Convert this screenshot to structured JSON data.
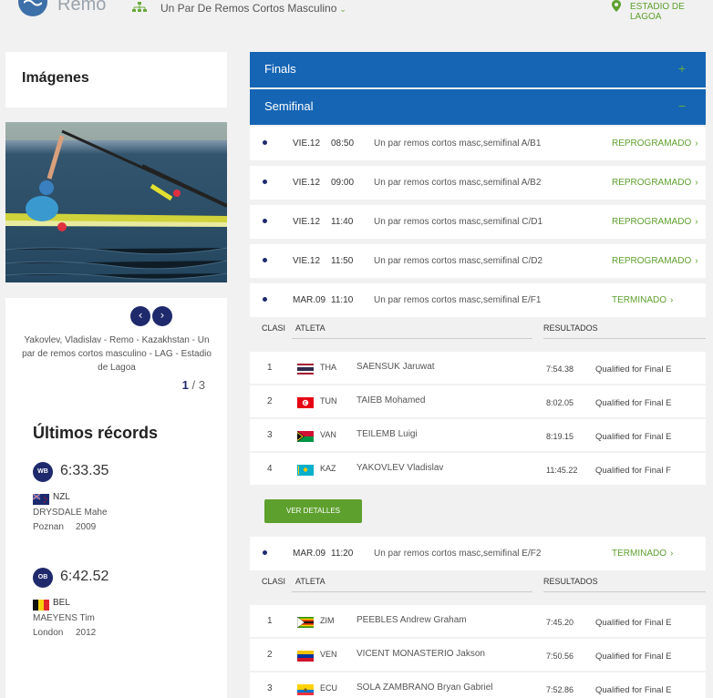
{
  "header": {
    "sport": "Remo",
    "event": "Un Par De Remos Cortos Masculino",
    "venue": "ESTADIO DE LAGOA"
  },
  "colors": {
    "brand_blue": "#1565b4",
    "accent_green": "#5ea02e",
    "navy": "#1f2a6d"
  },
  "images": {
    "title": "Imágenes",
    "caption": "Yakovlev, Vladislav - Remo - Kazakhstan - Un par de remos cortos masculino - LAG - Estadio de Lagoa",
    "current": "1",
    "total": "/ 3",
    "prev_icon": "‹",
    "next_icon": "›"
  },
  "records": {
    "title": "Últimos récords",
    "items": [
      {
        "badge": "WB",
        "time": "6:33.35",
        "noc": "NZL",
        "name": "DRYSDALE Mahe",
        "place": "Poznan",
        "year": "2009"
      },
      {
        "badge": "OB",
        "time": "6:42.52",
        "noc": "BEL",
        "name": "MAEYENS Tim",
        "place": "London",
        "year": "2012"
      }
    ]
  },
  "phases": [
    {
      "label": "Finals",
      "toggle": "+"
    },
    {
      "label": "Semifinal",
      "toggle": "−"
    }
  ],
  "races": [
    {
      "day": "VIE.12",
      "time": "08:50",
      "title": "Un par remos cortos masc,semifinal A/B1",
      "status": "REPROGRAMADO"
    },
    {
      "day": "VIE.12",
      "time": "09:00",
      "title": "Un par remos cortos masc,semifinal A/B2",
      "status": "REPROGRAMADO"
    },
    {
      "day": "VIE.12",
      "time": "11:40",
      "title": "Un par remos cortos masc,semifinal C/D1",
      "status": "REPROGRAMADO"
    },
    {
      "day": "VIE.12",
      "time": "11:50",
      "title": "Un par remos cortos masc,semifinal C/D2",
      "status": "REPROGRAMADO"
    },
    {
      "day": "MAR.09",
      "time": "11:10",
      "title": "Un par remos cortos masc,semifinal E/F1",
      "status": "TERMINADO"
    },
    {
      "day": "MAR.09",
      "time": "11:20",
      "title": "Un par remos cortos masc,semifinal E/F2",
      "status": "TERMINADO"
    }
  ],
  "results_header": {
    "rank": "CLASI",
    "athlete": "ATLETA",
    "results": "RESULTADOS"
  },
  "results_ef1": [
    {
      "rank": "1",
      "noc": "THA",
      "name": "SAENSUK Jaruwat",
      "mark": "7:54.38",
      "qual": "Qualified for Final E"
    },
    {
      "rank": "2",
      "noc": "TUN",
      "name": "TAIEB Mohamed",
      "mark": "8:02.05",
      "qual": "Qualified for Final E"
    },
    {
      "rank": "3",
      "noc": "VAN",
      "name": "TEILEMB Luigi",
      "mark": "8:19.15",
      "qual": "Qualified for Final E"
    },
    {
      "rank": "4",
      "noc": "KAZ",
      "name": "YAKOVLEV Vladislav",
      "mark": "11:45.22",
      "qual": "Qualified for Final F"
    }
  ],
  "details_label": "VER DETALLES",
  "results_ef2": [
    {
      "rank": "1",
      "noc": "ZIM",
      "name": "PEEBLES Andrew Graham",
      "mark": "7:45.20",
      "qual": "Qualified for Final E"
    },
    {
      "rank": "2",
      "noc": "VEN",
      "name": "VICENT MONASTERIO Jakson",
      "mark": "7:50.56",
      "qual": "Qualified for Final E"
    },
    {
      "rank": "3",
      "noc": "ECU",
      "name": "SOLA ZAMBRANO Bryan Gabriel",
      "mark": "7:52.86",
      "qual": "Qualified for Final E"
    }
  ]
}
